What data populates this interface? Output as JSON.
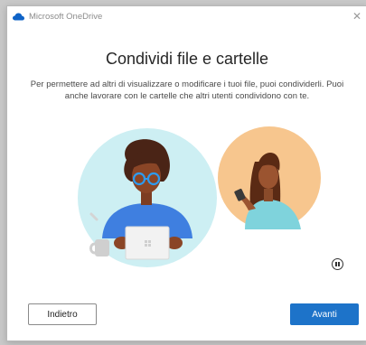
{
  "window": {
    "app_title": "Microsoft OneDrive",
    "close_icon": "close-icon",
    "app_icon": "onedrive-cloud-icon"
  },
  "main": {
    "heading": "Condividi file e cartelle",
    "description": "Per permettere ad altri di visualizzare o modificare i tuoi file, puoi condividerli. Puoi anche lavorare con le cartelle che altri utenti condividono con te.",
    "illustration": "sharing-people-illustration",
    "pause_icon": "pause-icon"
  },
  "footer": {
    "back_label": "Indietro",
    "next_label": "Avanti"
  },
  "colors": {
    "accent": "#1d73c9",
    "circle_left": "#cdeff3",
    "circle_right": "#f7c68e"
  }
}
